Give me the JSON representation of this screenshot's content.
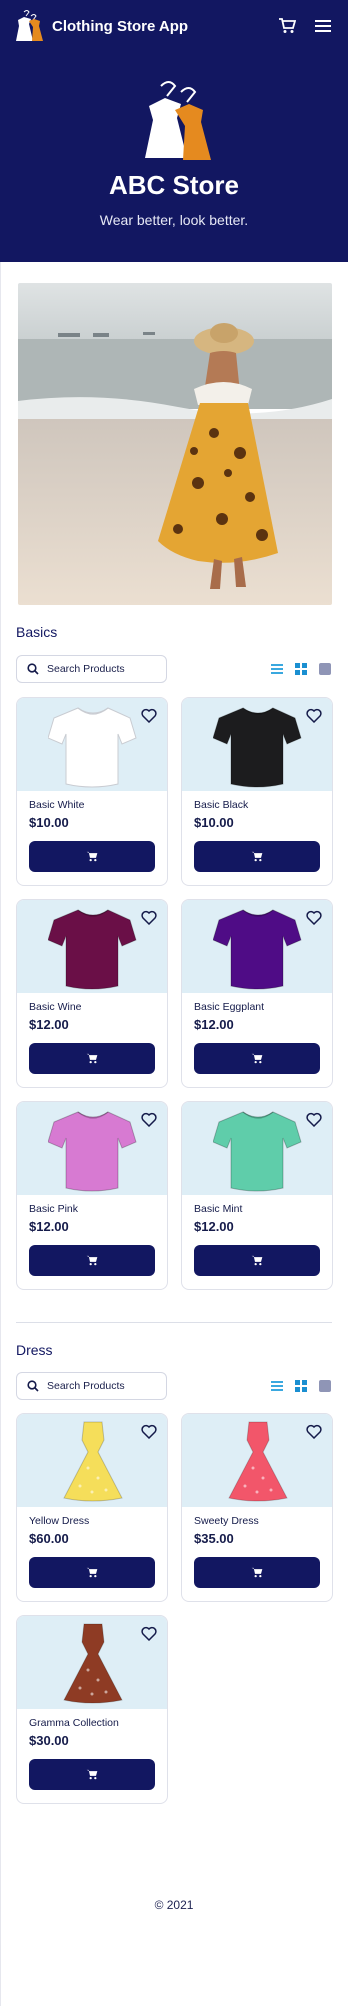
{
  "app": {
    "title": "Clothing Store App"
  },
  "hero": {
    "store_name": "ABC Store",
    "tagline": "Wear better, look better."
  },
  "sections": [
    {
      "title": "Basics",
      "search_placeholder": "Search Products",
      "products": [
        {
          "name": "Basic White",
          "price": "$10.00",
          "color": "#ffffff",
          "shape": "tee"
        },
        {
          "name": "Basic Black",
          "price": "$10.00",
          "color": "#1c1c1e",
          "shape": "tee"
        },
        {
          "name": "Basic Wine",
          "price": "$12.00",
          "color": "#6a0f47",
          "shape": "tee"
        },
        {
          "name": "Basic Eggplant",
          "price": "$12.00",
          "color": "#4f0c86",
          "shape": "tee"
        },
        {
          "name": "Basic Pink",
          "price": "$12.00",
          "color": "#d77ad2",
          "shape": "tee"
        },
        {
          "name": "Basic Mint",
          "price": "$12.00",
          "color": "#5fcdaa",
          "shape": "tee"
        }
      ]
    },
    {
      "title": "Dress",
      "search_placeholder": "Search Products",
      "products": [
        {
          "name": "Yellow Dress",
          "price": "$60.00",
          "color": "#f5de5a",
          "shape": "dress"
        },
        {
          "name": "Sweety Dress",
          "price": "$35.00",
          "color": "#f2566a",
          "shape": "dress"
        },
        {
          "name": "Gramma Collection",
          "price": "$30.00",
          "color": "#8e3b24",
          "shape": "dress"
        }
      ]
    }
  ],
  "footer": {
    "copyright": "© 2021"
  }
}
